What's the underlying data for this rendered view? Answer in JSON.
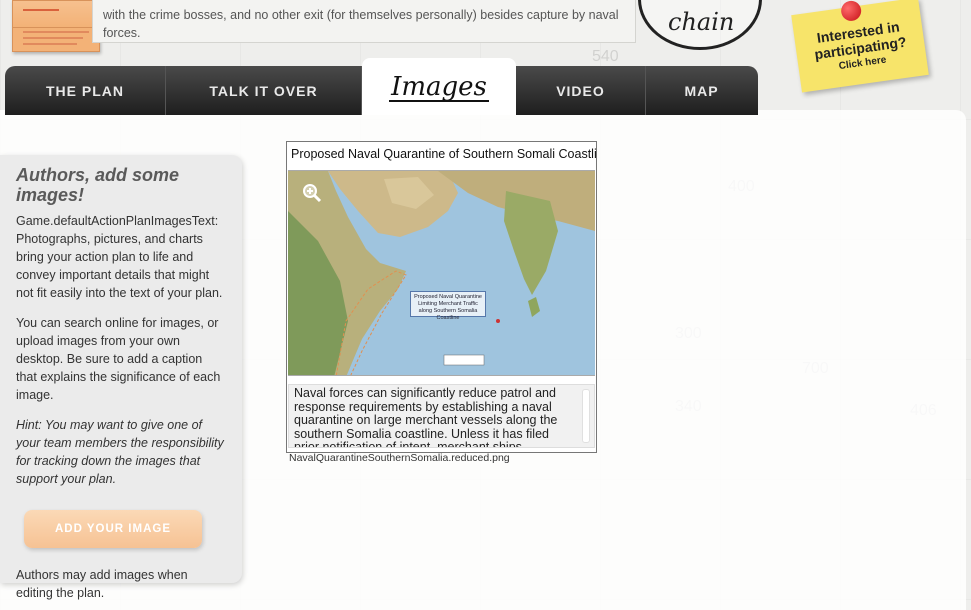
{
  "intro": {
    "line1": "with the crime bosses, and no other exit (for themselves personally) besides capture by naval",
    "line2": "forces."
  },
  "brand": {
    "chain_text": "chain"
  },
  "sticky_note": {
    "line1": "Interested in",
    "line2": "participating?",
    "line3": "Click here"
  },
  "tabs": [
    {
      "label": "THE PLAN",
      "active": false
    },
    {
      "label": "TALK IT OVER",
      "active": false
    },
    {
      "label": "Images",
      "active": true
    },
    {
      "label": "VIDEO",
      "active": false
    },
    {
      "label": "MAP",
      "active": false
    }
  ],
  "sidebar": {
    "title": "Authors, add some images!",
    "para1": "Game.defaultActionPlanImagesText: Photographs, pictures, and charts bring your action plan to life and convey important details that might not fit easily into the text of your plan.",
    "para2": "You can search online for images, or upload images from your own desktop. Be sure to add a caption that explains the significance of each image.",
    "hint": "Hint: You may want to give one of your team members the responsibility for tracking down the images that support your plan.",
    "add_button": "ADD YOUR IMAGE",
    "footer": "Authors may add images when editing the plan."
  },
  "image_card": {
    "title": "Proposed Naval Quarantine of Southern Somali Coastlin",
    "map_label": "Proposed Naval Quarantine Limiting Merchant Traffic along Southern Somalia Coastline",
    "caption": "Naval forces can significantly reduce patrol and response requirements by establishing a naval quarantine on large merchant vessels along the southern Somalia coastline.  Unless it has filed prior notification of intent, merchant ships approaching",
    "filename": "NavalQuarantineSouthernSomalia.reduced.png"
  },
  "background_numbers": [
    "540",
    "400",
    "406",
    "700",
    "300",
    "340"
  ],
  "colors": {
    "tab_bar": "#2a2a2a",
    "add_button": "#f6c294",
    "sticky": "#f7e46a",
    "pin": "#c50f14"
  },
  "icons": [
    "zoom-in-icon",
    "pushpin-icon",
    "envelope-icon"
  ]
}
